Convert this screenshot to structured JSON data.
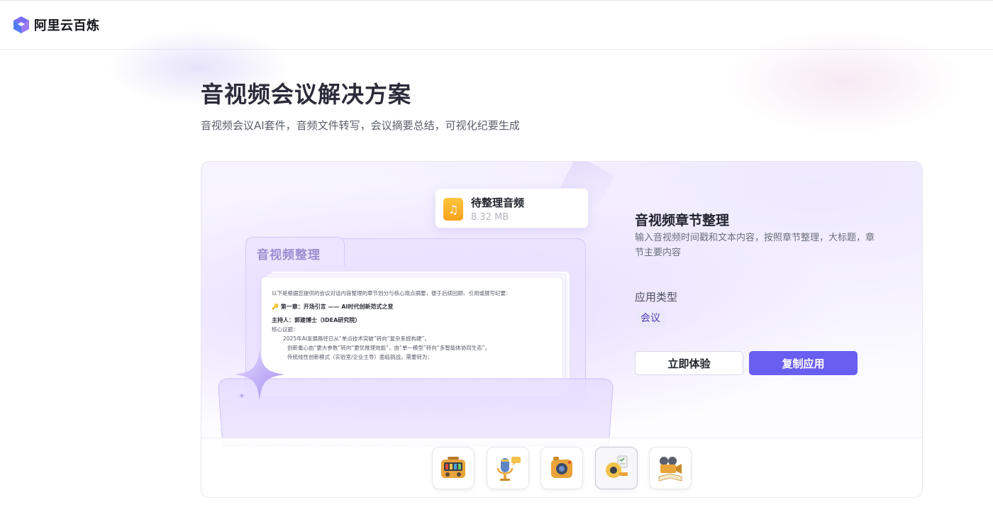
{
  "header": {
    "brand": "阿里云百炼",
    "logo_icon": "bailian-cube-logo"
  },
  "page": {
    "title": "音视频会议解决方案",
    "subtitle": "音视频会议AI套件，音频文件转写，会议摘要总结，可视化纪要生成"
  },
  "hero": {
    "folder_label": "音视频整理",
    "file": {
      "name": "待整理音频",
      "size": "8.32 MB",
      "icon": "music-note-icon"
    },
    "doc_lines": [
      "以下是根据您提供的会议对话内容整理的章节划分与核心观点摘要，便于后续回顾、引用或撰写纪要：",
      "🔑 第一章：开场引言 —— AI时代创新范式之变",
      "主持人：郭建博士（IDEA研究院）",
      "核心议题：",
      "2025年AI发展路径已从“单点技术突破”转向“复杂系统构建”。",
      "创新重心由“更大参数”转向“更优推理效能”，由“单一模型”转向“多智能体协同生态”。",
      "传统线性创新模式（实验室/企业主导）面临挑战，需要转为："
    ]
  },
  "app": {
    "title": "音视频章节整理",
    "description": "输入音视频时间戳和文本内容，按照章节整理，大标题，章节主要内容",
    "type_label": "应用类型",
    "type_tag": "会议",
    "try_button": "立即体验",
    "copy_button": "复制应用"
  },
  "thumbnails": [
    {
      "icon": "retro-radio-icon"
    },
    {
      "icon": "microphone-chat-icon"
    },
    {
      "icon": "speaker-camera-icon"
    },
    {
      "icon": "tape-measure-checklist-icon"
    },
    {
      "icon": "film-camera-book-icon"
    }
  ],
  "colors": {
    "accent": "#6a5ef0",
    "tag_bg": "#ece8fb",
    "tag_text": "#4d3fb8",
    "file_icon": "#f7a21b"
  }
}
